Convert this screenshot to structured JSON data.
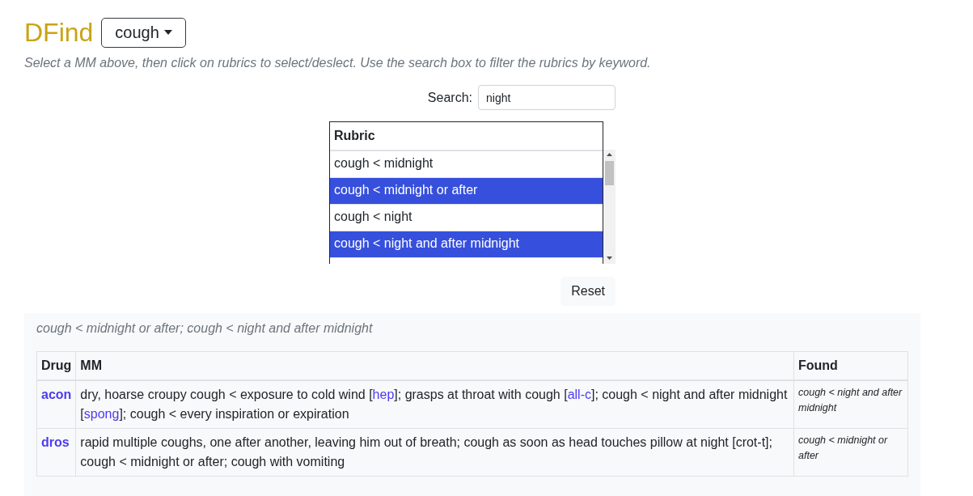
{
  "header": {
    "title": "DFind",
    "dropdown": "cough"
  },
  "instructions": "Select a MM above, then click on rubrics to select/deslect. Use the search box to filter the rubrics by keyword.",
  "search": {
    "label": "Search:",
    "value": "night"
  },
  "rubric_list": {
    "heading": "Rubric",
    "items": [
      {
        "label": "cough < midnight",
        "selected": false
      },
      {
        "label": "cough < midnight or after",
        "selected": true
      },
      {
        "label": "cough < night",
        "selected": false
      },
      {
        "label": "cough < night and after midnight",
        "selected": true
      }
    ]
  },
  "reset_button": "Reset",
  "results": {
    "summary": "cough < midnight or after; cough < night and after midnight",
    "table": {
      "columns": [
        "Drug",
        "MM",
        "Found"
      ],
      "rows": [
        {
          "drug": "acon",
          "mm": [
            {
              "kind": "text",
              "text": "dry, hoarse croupy cough < exposure to cold wind ["
            },
            {
              "kind": "link",
              "text": "hep"
            },
            {
              "kind": "text",
              "text": "]; grasps at throat with cough ["
            },
            {
              "kind": "link",
              "text": "all-c"
            },
            {
              "kind": "text",
              "text": "]; cough < night and after midnight ["
            },
            {
              "kind": "link",
              "text": "spong"
            },
            {
              "kind": "text",
              "text": "]; cough < every inspiration or expiration"
            }
          ],
          "found": "cough < night and after midnight"
        },
        {
          "drug": "dros",
          "mm": [
            {
              "kind": "text",
              "text": "rapid multiple coughs, one after another, leaving him out of breath; cough as soon as head touches pillow at night [crot-t]; cough < midnight or after; cough with vomiting"
            }
          ],
          "found": "cough < midnight or after"
        }
      ]
    }
  }
}
